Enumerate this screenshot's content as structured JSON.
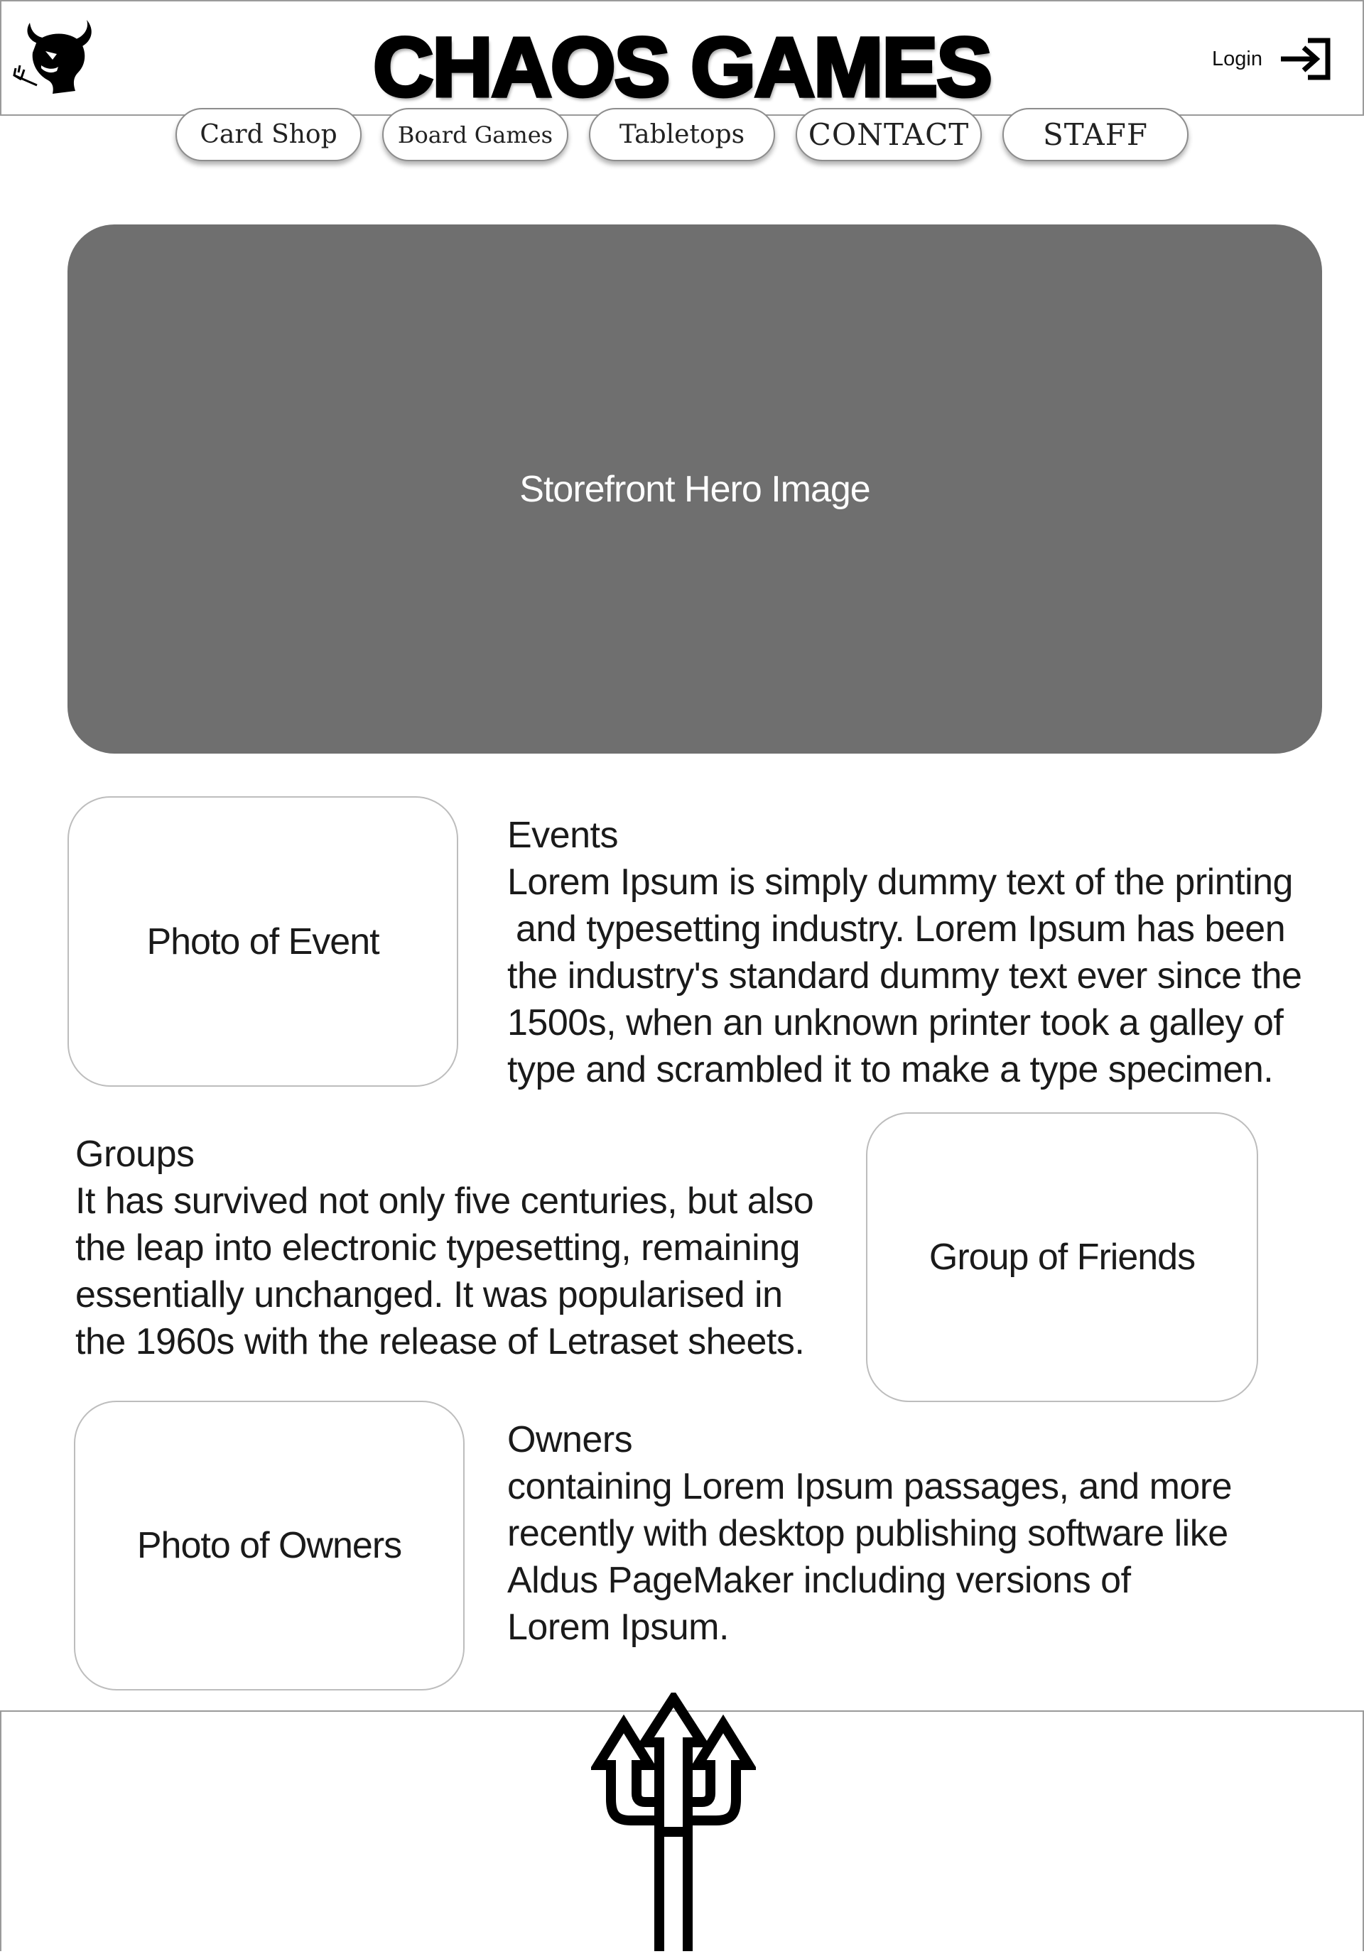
{
  "header": {
    "title": "CHAOS GAMES",
    "login_label": "Login",
    "logo_icon": "devil-head-icon",
    "login_icon": "login-arrow-icon"
  },
  "nav": {
    "items": [
      {
        "label": "Card Shop"
      },
      {
        "label": "Board Games"
      },
      {
        "label": "Tabletops"
      },
      {
        "label": "CONTACT"
      },
      {
        "label": "STAFF"
      }
    ]
  },
  "hero": {
    "label": "Storefront Hero Image",
    "color": "#6f6f6f"
  },
  "events": {
    "photo_label": "Photo of Event",
    "heading": "Events",
    "lines": [
      "Lorem Ipsum is simply dummy text of the printing",
      "and typesetting industry. Lorem Ipsum has been",
      "the industry's standard dummy text ever since the",
      "1500s, when an unknown printer took a galley of",
      "type and scrambled it to make a type specimen."
    ]
  },
  "groups": {
    "photo_label": "Group of Friends",
    "heading": "Groups",
    "lines": [
      "It has survived not only five centuries, but also",
      "the leap into electronic typesetting, remaining",
      "essentially unchanged. It was popularised in",
      "the 1960s with the release of Letraset sheets."
    ]
  },
  "owners": {
    "photo_label": "Photo of Owners",
    "heading": "Owners",
    "lines": [
      "containing Lorem Ipsum passages, and more",
      "recently with desktop publishing software like",
      "Aldus PageMaker including versions of",
      "Lorem Ipsum."
    ]
  },
  "footer": {
    "icon": "trident-icon"
  }
}
